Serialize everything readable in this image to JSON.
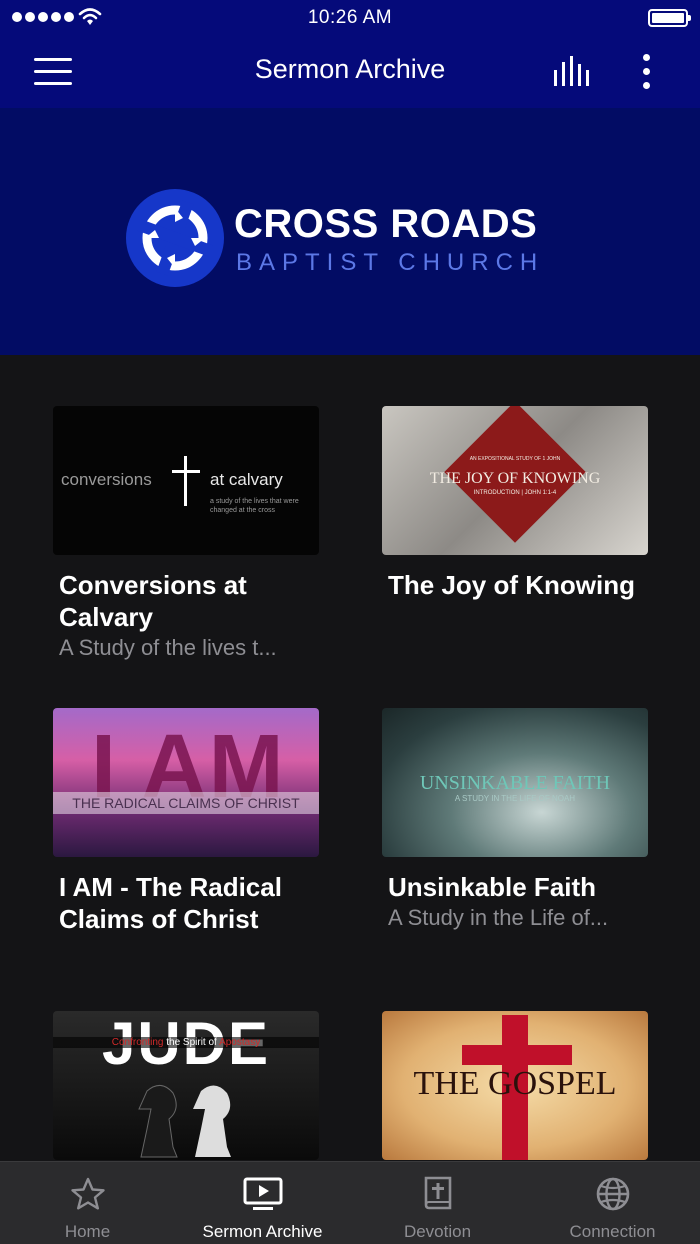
{
  "status_bar": {
    "time": "10:26 AM"
  },
  "nav": {
    "title": "Sermon Archive"
  },
  "banner": {
    "logo_title": "CROSS ROADS",
    "logo_subtitle": "BAPTIST CHURCH"
  },
  "sermons": [
    {
      "title": "Conversions at Calvary",
      "subtitle": "A Study of the lives t...",
      "thumb": {
        "left": "conversions",
        "right": "at calvary",
        "small": "a study of the lives that were changed at the cross"
      }
    },
    {
      "title": "The Joy of Knowing",
      "subtitle": "",
      "thumb": {
        "top": "AN EXPOSITIONAL STUDY OF 1 JOHN",
        "main": "THE JOY OF KNOWING",
        "sub": "INTRODUCTION | JOHN 1:1-4"
      }
    },
    {
      "title": "I AM - The Radical Claims of Christ",
      "subtitle": "",
      "thumb": {
        "big": "I AM",
        "main": "THE RADICAL CLAIMS OF CHRIST"
      }
    },
    {
      "title": "Unsinkable Faith",
      "subtitle": "A Study in the Life of...",
      "thumb": {
        "main": "UNSINKABLE FAITH",
        "sub": "A STUDY IN THE LIFE OF NOAH"
      }
    },
    {
      "title": "",
      "subtitle": "",
      "thumb": {
        "big": "JUDE",
        "sub_a": "Confronting",
        "sub_b": "the Spirit of",
        "sub_c": "Apostasy"
      }
    },
    {
      "title": "",
      "subtitle": "",
      "thumb": {
        "main": "THE GOSPEL"
      }
    }
  ],
  "tabs": [
    {
      "label": "Home",
      "icon": "star-icon",
      "active": false
    },
    {
      "label": "Sermon Archive",
      "icon": "tv-play-icon",
      "active": true
    },
    {
      "label": "Devotion",
      "icon": "bible-icon",
      "active": false
    },
    {
      "label": "Connection",
      "icon": "globe-icon",
      "active": false
    }
  ],
  "colors": {
    "nav_bg": "#050a7a",
    "banner_bg": "#020c64",
    "accent": "#5c78e6",
    "bg": "#141416"
  }
}
